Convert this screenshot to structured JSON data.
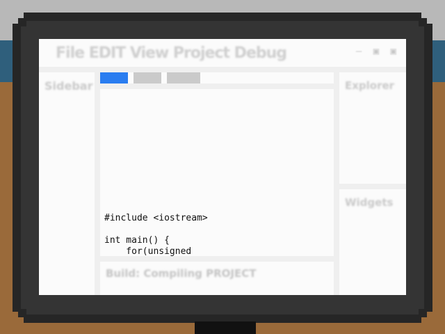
{
  "menu_bar": "File EDIT View Project Debug",
  "window_controls": "— ▣ ▣",
  "sidebar": {
    "label": "Sidebar"
  },
  "tabs": [
    {
      "label": "",
      "active": true,
      "color": "#2a7df0"
    },
    {
      "label": "",
      "active": false,
      "color": "#cacaca"
    },
    {
      "label": "",
      "active": false,
      "color": "#cacaca"
    }
  ],
  "editor": {
    "code": "#include <iostream>\n\nint main() {\n    for(unsigned"
  },
  "output": {
    "text": "Build: Compiling PROJECT"
  },
  "explorer": {
    "label": "Explorer"
  },
  "widgets": {
    "label": "Widgets"
  },
  "colors": {
    "accent": "#2a7df0",
    "bezel": "#262626",
    "desk": "#9a6a3a"
  }
}
